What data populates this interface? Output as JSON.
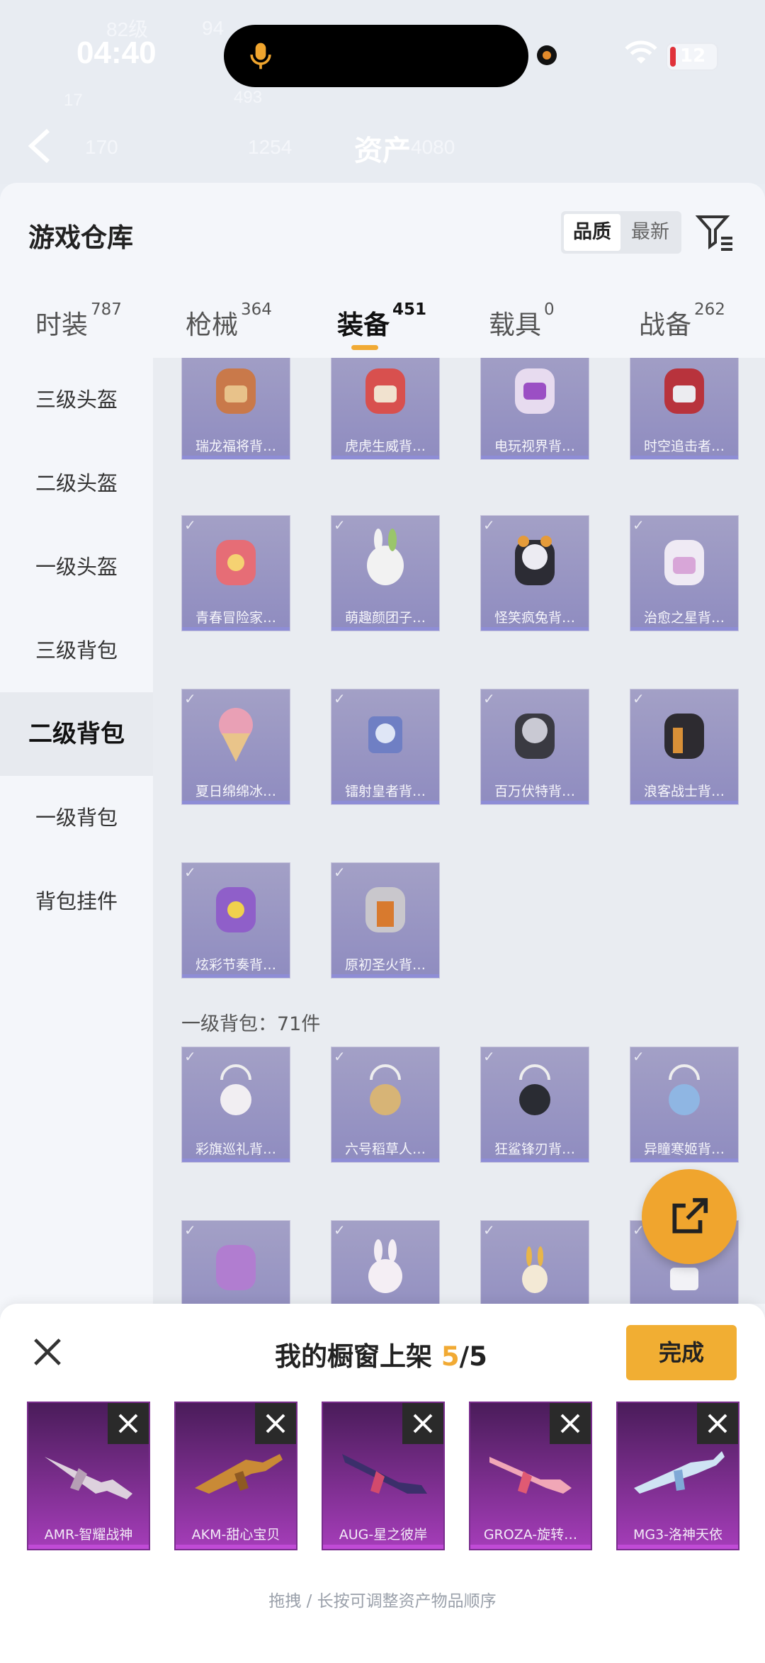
{
  "status": {
    "time": "04:40",
    "battery": "12",
    "faded_overlay": [
      "82级",
      "94",
      "17",
      "493",
      "170",
      "1254",
      "4080"
    ]
  },
  "header": {
    "asset_title": "资产"
  },
  "warehouse": {
    "title": "游戏仓库",
    "sort_options": [
      "品质",
      "最新"
    ],
    "tabs": [
      {
        "label": "时装",
        "count": "787"
      },
      {
        "label": "枪械",
        "count": "364"
      },
      {
        "label": "装备",
        "count": "451"
      },
      {
        "label": "载具",
        "count": "0"
      },
      {
        "label": "战备",
        "count": "262"
      }
    ],
    "active_tab": "装备",
    "sidebar": [
      "三级头盔",
      "二级头盔",
      "一级头盔",
      "三级背包",
      "二级背包",
      "一级背包",
      "背包挂件"
    ],
    "active_side": "二级背包",
    "items": [
      [
        "瑞龙福将背…",
        "虎虎生威背…",
        "电玩视界背…",
        "时空追击者…"
      ],
      [
        "青春冒险家…",
        "萌趣颜团子…",
        "怪笑疯兔背…",
        "治愈之星背…"
      ],
      [
        "夏日绵绵冰…",
        "镭射皇者背…",
        "百万伏特背…",
        "浪客战士背…"
      ],
      [
        "炫彩节奏背…",
        "原初圣火背…"
      ]
    ],
    "section_label": "一级背包：71件",
    "items2": [
      [
        "彩旗巡礼背…",
        "六号稻草人…",
        "狂鲨锋刃背…",
        "异瞳寒姬背…"
      ]
    ]
  },
  "shelf": {
    "title": "我的橱窗上架 ",
    "count": "5",
    "total": "/5",
    "done": "完成",
    "guns": [
      "AMR-智耀战神",
      "AKM-甜心宝贝",
      "AUG-星之彼岸",
      "GROZA-旋转…",
      "MG3-洛神天依"
    ],
    "hint": "拖拽 / 长按可调整资产物品顺序"
  },
  "colors": {
    "accent": "#f1aa34",
    "card": "#9b98c4",
    "gun_card": "#8a2fa3"
  }
}
